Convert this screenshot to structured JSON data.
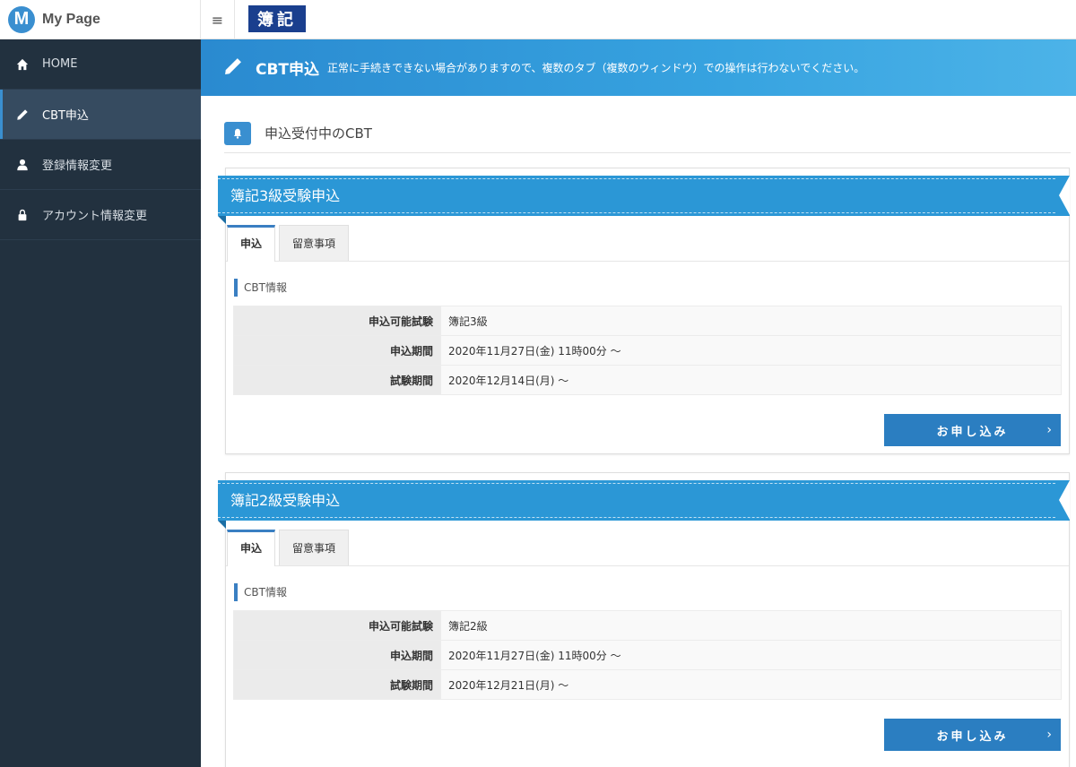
{
  "brand": {
    "logo_letter": "M",
    "name": "My Page"
  },
  "sidebar": {
    "items": [
      {
        "label": "HOME",
        "icon": "home-icon",
        "active": false
      },
      {
        "label": "CBT申込",
        "icon": "pencil-icon",
        "active": true
      },
      {
        "label": "登録情報変更",
        "icon": "user-icon",
        "active": false
      },
      {
        "label": "アカウント情報変更",
        "icon": "lock-icon",
        "active": false
      }
    ]
  },
  "header": {
    "menu_icon": "≡",
    "logo_text": "簿記"
  },
  "banner": {
    "title": "CBT申込",
    "note": "正常に手続きできない場合がありますので、複数のタブ（複数のウィンドウ）での操作は行わないでください。"
  },
  "section": {
    "title": "申込受付中のCBT"
  },
  "cards": [
    {
      "ribbon_title": "簿記3級受験申込",
      "tabs": [
        "申込",
        "留意事項"
      ],
      "info_label": "CBT情報",
      "rows": [
        {
          "key": "申込可能試験",
          "value": "簿記3級"
        },
        {
          "key": "申込期間",
          "value": "2020年11月27日(金) 11時00分 〜"
        },
        {
          "key": "試験期間",
          "value": "2020年12月14日(月) 〜"
        }
      ],
      "button_label": "お申し込み",
      "button_chevron": "›"
    },
    {
      "ribbon_title": "簿記2級受験申込",
      "tabs": [
        "申込",
        "留意事項"
      ],
      "info_label": "CBT情報",
      "rows": [
        {
          "key": "申込可能試験",
          "value": "簿記2級"
        },
        {
          "key": "申込期間",
          "value": "2020年11月27日(金) 11時00分 〜"
        },
        {
          "key": "試験期間",
          "value": "2020年12月21日(月) 〜"
        }
      ],
      "button_label": "お申し込み",
      "button_chevron": "›"
    }
  ],
  "colors": {
    "sidebar": "#22313f",
    "accent": "#2b97d6",
    "button": "#2b7ec1",
    "logo": "#1a3f8e"
  }
}
